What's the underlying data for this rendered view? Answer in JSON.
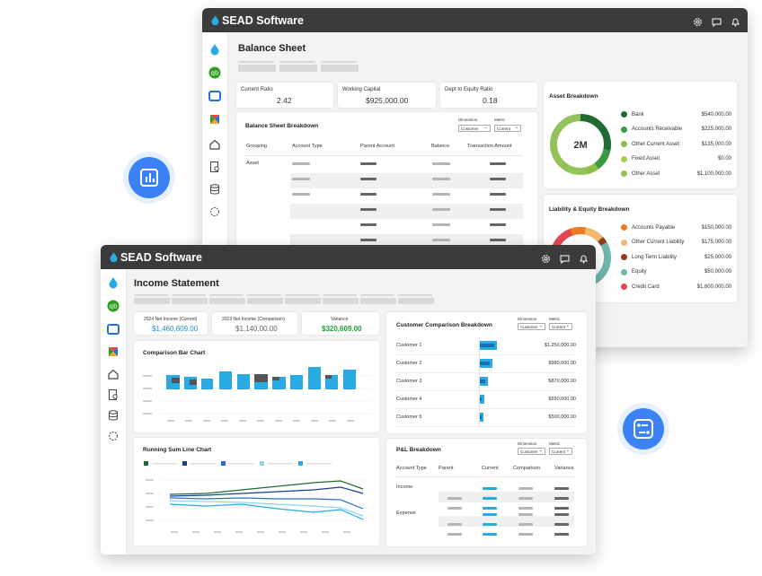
{
  "balance_window": {
    "brand": "SEAD Software",
    "page_title": "Balance Sheet",
    "kpis": [
      {
        "label": "Current Ratio",
        "value": "2.42"
      },
      {
        "label": "Working Capital",
        "value": "$925,000.00"
      },
      {
        "label": "Dept to Equity Ratio",
        "value": "0.18"
      }
    ],
    "breakdown": {
      "title": "Balance Sheet Breakdown",
      "dimension_label": "Dimension",
      "dimension_value": "Customer",
      "metric_label": "Metric",
      "metric_value": "Current",
      "columns": [
        "Grouping",
        "Account Type",
        "Parent Account",
        "Balance",
        "Transaction Amount"
      ],
      "first_group": "Asset"
    },
    "asset_breakdown": {
      "title": "Asset Breakdown",
      "center_label": "2M",
      "items": [
        {
          "label": "Bank",
          "value": "$540,000.00",
          "color": "#1e6b34"
        },
        {
          "label": "Accounts Receivable",
          "value": "$225,000.00",
          "color": "#3a9a45"
        },
        {
          "label": "Other Current Asset",
          "value": "$135,000.00",
          "color": "#8dbe4a"
        },
        {
          "label": "Fixed Asset",
          "value": "$0.00",
          "color": "#a6cf59"
        },
        {
          "label": "Other Asset",
          "value": "$1,100,000.00",
          "color": "#92c35a"
        }
      ]
    },
    "liability_breakdown": {
      "title": "Liability & Equity Breakdown",
      "items": [
        {
          "label": "Accounts Payable",
          "value": "$150,000.00",
          "color": "#f07a1f"
        },
        {
          "label": "Other Current Liability",
          "value": "$175,000.00",
          "color": "#f5b56b"
        },
        {
          "label": "Long Term Liability",
          "value": "$25,000.00",
          "color": "#9a3a12"
        },
        {
          "label": "Equity",
          "value": "$50,000.00",
          "color": "#6fb7b0"
        },
        {
          "label": "Credit Card",
          "value": "$1,600,000.00",
          "color": "#e2474f"
        }
      ]
    }
  },
  "income_window": {
    "brand": "SEAD Software",
    "page_title": "Income Statement",
    "kpis": [
      {
        "label": "2024 Net Income (Current)",
        "value": "$1,460,609.00",
        "color": "#1a8fd6"
      },
      {
        "label": "2023 Net Income (Comparison)",
        "value": "$1,140,00.00",
        "color": "#555555"
      },
      {
        "label": "Variance",
        "value": "$320,609.00",
        "color": "#1f9a3c"
      }
    ],
    "comparison_bar_chart": {
      "title": "Comparison Bar Chart"
    },
    "running_sum_chart": {
      "title": "Running Sum Line Chart"
    },
    "customer_comparison": {
      "title": "Customer Comparison Breakdown",
      "dimension_label": "Dimension",
      "dimension_value": "Customer",
      "metric_label": "Metric",
      "metric_value": "Current",
      "rows": [
        {
          "label": "Customer 1",
          "value": "$1,250,000.00"
        },
        {
          "label": "Customer 2",
          "value": "$980,000.00"
        },
        {
          "label": "Customer 3",
          "value": "$870,000.00"
        },
        {
          "label": "Customer 4",
          "value": "$650,000.00"
        },
        {
          "label": "Customer 5",
          "value": "$500,000.00"
        }
      ]
    },
    "pl_breakdown": {
      "title": "P&L Breakdown",
      "dimension_label": "Dimension",
      "dimension_value": "Customer",
      "metric_label": "Metric",
      "metric_value": "Current",
      "columns": [
        "Account Type",
        "Parent",
        "Current",
        "Comparison",
        "Variance"
      ],
      "groups": [
        "Income",
        "Expense"
      ]
    }
  }
}
